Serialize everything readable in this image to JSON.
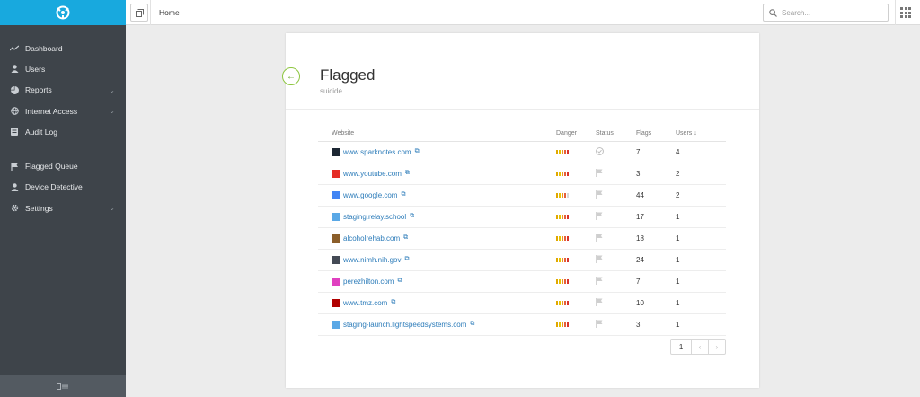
{
  "sidebar": {
    "items": [
      {
        "label": "Dashboard",
        "icon": "chart-line-icon"
      },
      {
        "label": "Users",
        "icon": "user-icon"
      },
      {
        "label": "Reports",
        "icon": "pie-chart-icon",
        "expandable": true
      },
      {
        "label": "Internet Access",
        "icon": "globe-icon",
        "expandable": true
      },
      {
        "label": "Audit Log",
        "icon": "log-icon"
      },
      {
        "label": "Flagged Queue",
        "icon": "flag-icon"
      },
      {
        "label": "Device Detective",
        "icon": "user-search-icon"
      },
      {
        "label": "Settings",
        "icon": "gear-icon",
        "expandable": true
      }
    ]
  },
  "topbar": {
    "breadcrumb": "Home",
    "search_placeholder": "Search..."
  },
  "page": {
    "title": "Flagged",
    "subtitle": "suicide"
  },
  "table": {
    "headers": {
      "website": "Website",
      "danger": "Danger",
      "status": "Status",
      "flags": "Flags",
      "users": "Users ↓"
    },
    "rows": [
      {
        "website": "www.sparknotes.com",
        "danger": 5,
        "status": "reviewed",
        "flags": "7",
        "users": "4",
        "favicon": "#1c2733"
      },
      {
        "website": "www.youtube.com",
        "danger": 5,
        "status": "flagged",
        "flags": "3",
        "users": "2",
        "favicon": "#e52d27"
      },
      {
        "website": "www.google.com",
        "danger": 4,
        "status": "flagged",
        "flags": "44",
        "users": "2",
        "favicon": "#4285f4"
      },
      {
        "website": "staging.relay.school",
        "danger": 5,
        "status": "flagged",
        "flags": "17",
        "users": "1",
        "favicon": "#5aa8e6"
      },
      {
        "website": "alcoholrehab.com",
        "danger": 5,
        "status": "flagged",
        "flags": "18",
        "users": "1",
        "favicon": "#8b5e2a"
      },
      {
        "website": "www.nimh.nih.gov",
        "danger": 5,
        "status": "flagged",
        "flags": "24",
        "users": "1",
        "favicon": "#444a55"
      },
      {
        "website": "perezhilton.com",
        "danger": 5,
        "status": "flagged",
        "flags": "7",
        "users": "1",
        "favicon": "#e040c0"
      },
      {
        "website": "www.tmz.com",
        "danger": 5,
        "status": "flagged",
        "flags": "10",
        "users": "1",
        "favicon": "#b00000"
      },
      {
        "website": "staging-launch.lightspeedsystems.com",
        "danger": 5,
        "status": "flagged",
        "flags": "3",
        "users": "1",
        "favicon": "#5aa8e6"
      }
    ]
  },
  "pagination": {
    "current": "1",
    "prev": "‹",
    "next": "›"
  },
  "colors": {
    "brand": "#18a9de",
    "sidebar": "#3e444a",
    "accent": "#8dc63f",
    "link": "#2b7bb9"
  }
}
